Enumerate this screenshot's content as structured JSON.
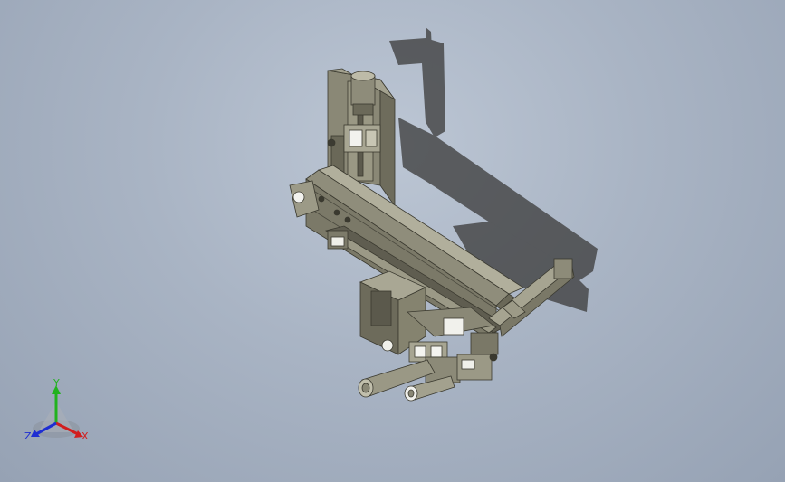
{
  "viewport": {
    "model": "linear-gantry-robot-assembly",
    "view": "isometric",
    "shaded_with_shadows": true
  },
  "triad": {
    "x_label": "X",
    "y_label": "Y",
    "z_label": "Z",
    "x_color": "#d21e1e",
    "y_color": "#21b21e",
    "z_color": "#1e2ed2"
  },
  "colors": {
    "background_top": "#bcc6d4",
    "background_bottom": "#96a2b4",
    "model_body": "#8c8a78",
    "model_dark": "#5d5b4e",
    "shadow": "#3f3f3f"
  }
}
